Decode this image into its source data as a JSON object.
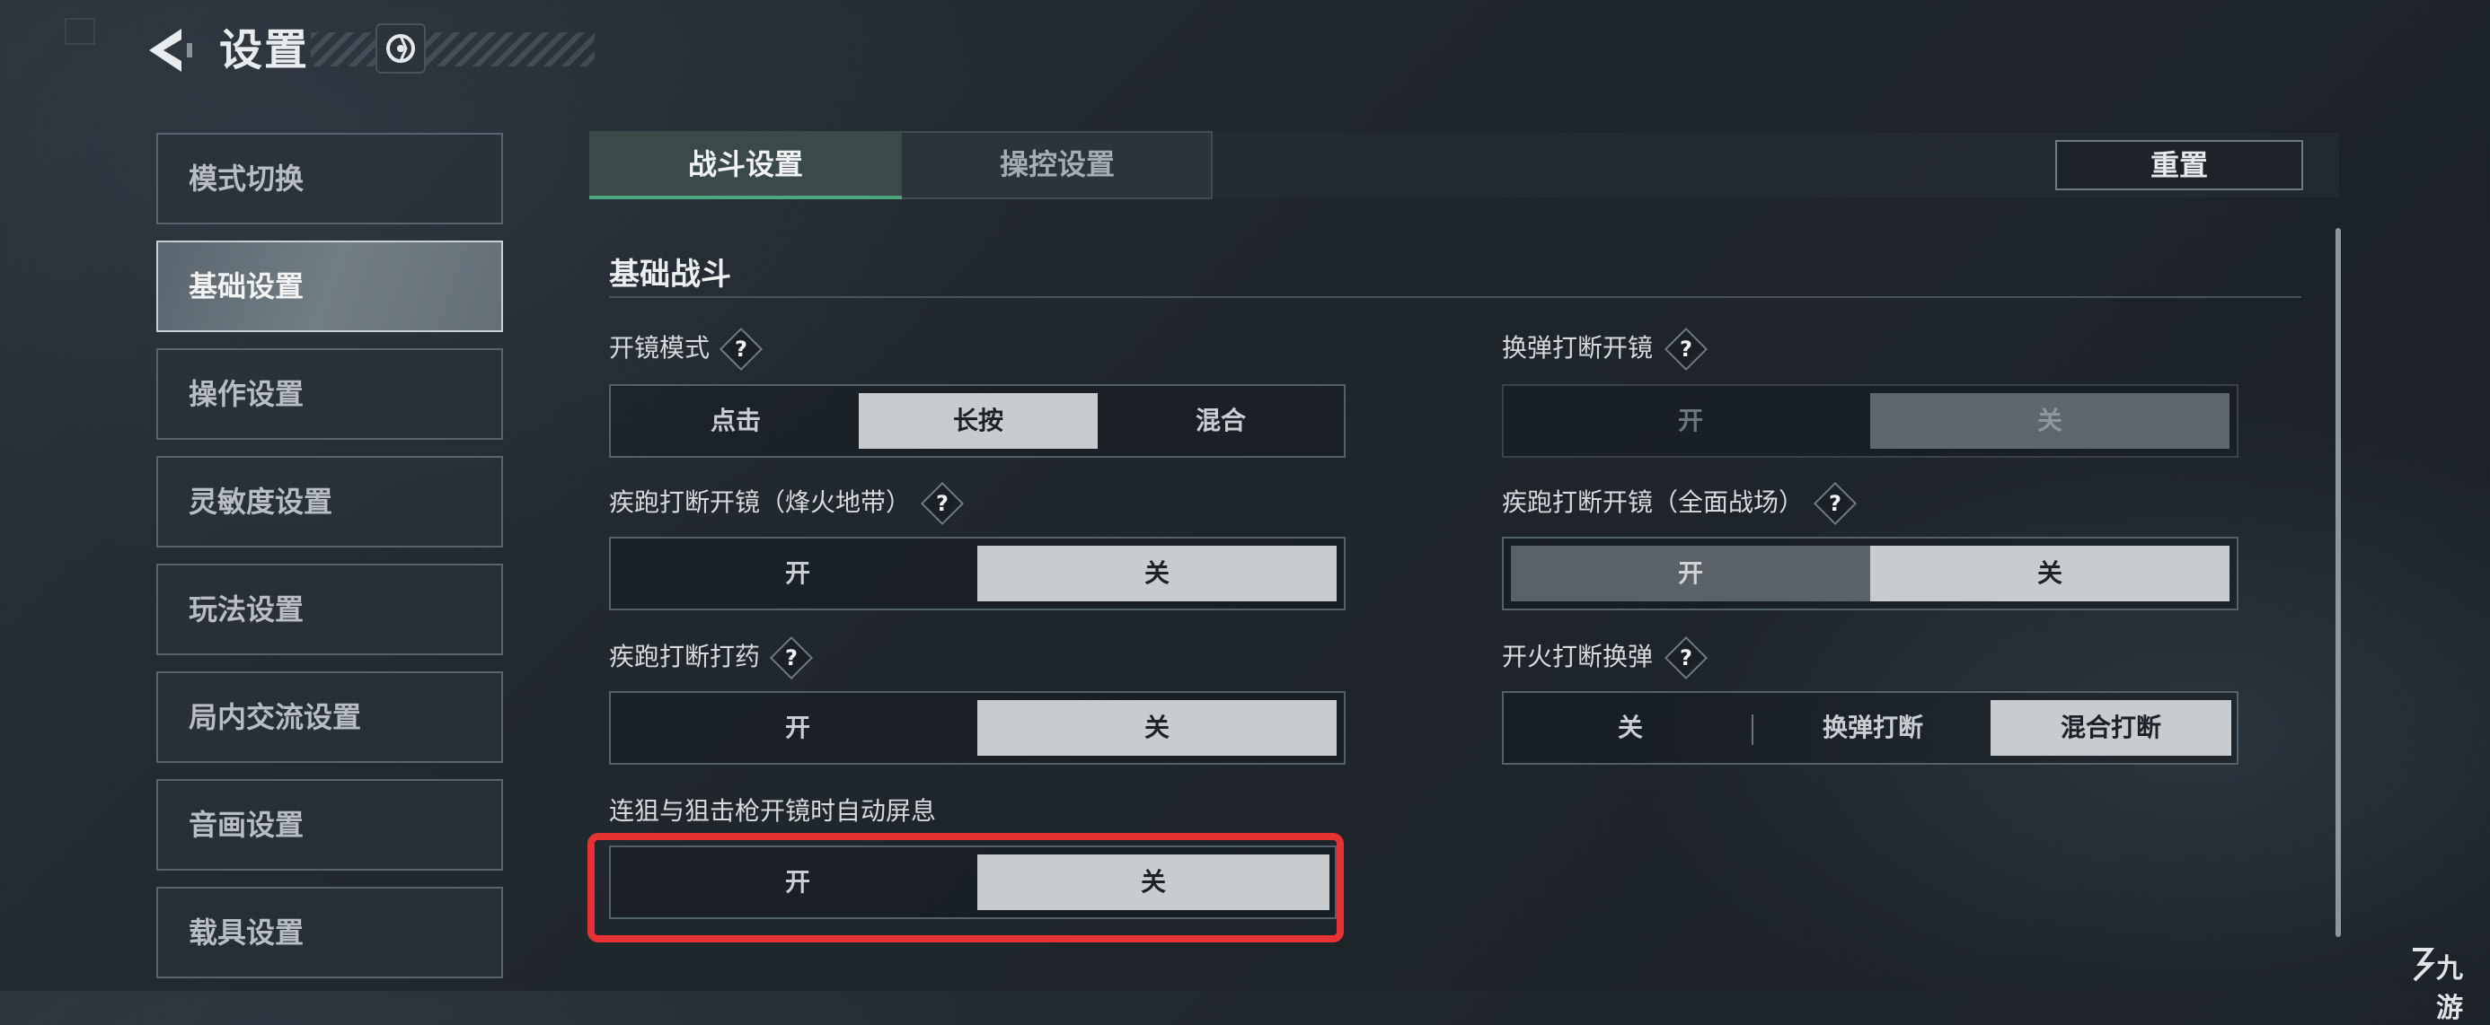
{
  "header": {
    "title": "设置"
  },
  "sidebar": {
    "items": [
      {
        "label": "模式切换"
      },
      {
        "label": "基础设置"
      },
      {
        "label": "操作设置"
      },
      {
        "label": "灵敏度设置"
      },
      {
        "label": "玩法设置"
      },
      {
        "label": "局内交流设置"
      },
      {
        "label": "音画设置"
      },
      {
        "label": "载具设置"
      }
    ],
    "active_index": 1
  },
  "tabs": [
    {
      "label": "战斗设置"
    },
    {
      "label": "操控设置"
    }
  ],
  "reset_label": "重置",
  "section": {
    "title": "基础战斗"
  },
  "help_glyph": "?",
  "settings": {
    "scope_mode": {
      "label": "开镜模式",
      "options": [
        "点击",
        "长按",
        "混合"
      ],
      "selected": "长按"
    },
    "reload_interrupt_scope": {
      "label": "换弹打断开镜",
      "options": [
        "开",
        "关"
      ],
      "selected": "关",
      "disabled": true
    },
    "sprint_interrupt_scope_beacon": {
      "label": "疾跑打断开镜（烽火地带）",
      "options": [
        "开",
        "关"
      ],
      "selected": "关"
    },
    "sprint_interrupt_scope_allout": {
      "label": "疾跑打断开镜（全面战场）",
      "options": [
        "开",
        "关"
      ],
      "selected": "关"
    },
    "sprint_interrupt_heal": {
      "label": "疾跑打断打药",
      "options": [
        "开",
        "关"
      ],
      "selected": "关"
    },
    "fire_interrupt_reload": {
      "label": "开火打断换弹",
      "options": [
        "关",
        "换弹打断",
        "混合打断"
      ],
      "selected": "混合打断"
    },
    "auto_hold_breath": {
      "label": "连狙与狙击枪开镜时自动屏息",
      "options": [
        "开",
        "关"
      ],
      "selected": "关"
    }
  },
  "colors": {
    "accent_green": "#4fa67e",
    "highlight_red": "#e53232"
  },
  "watermark": "九游"
}
